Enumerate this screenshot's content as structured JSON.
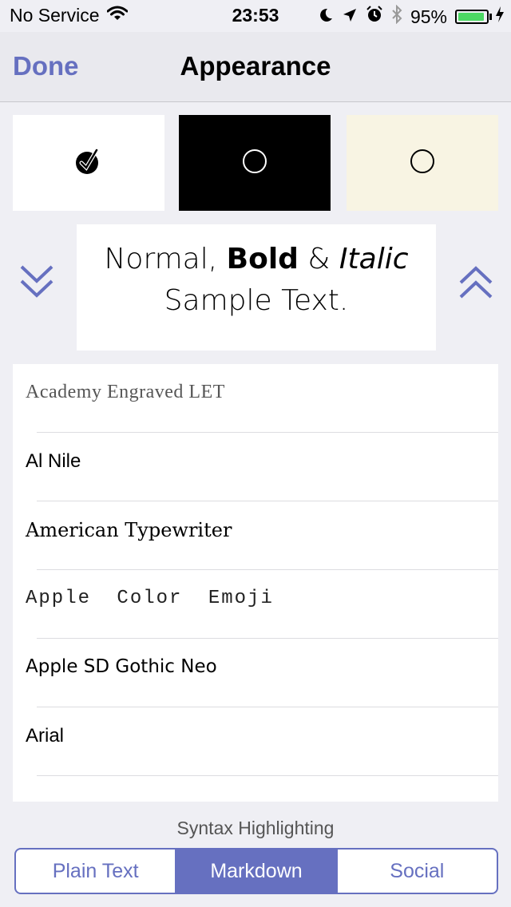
{
  "status_bar": {
    "carrier": "No Service",
    "time": "23:53",
    "battery_percent_label": "95%",
    "battery_level": 0.95,
    "icons": [
      "wifi-icon",
      "moon-icon",
      "location-arrow-icon",
      "alarm-icon",
      "bluetooth-icon",
      "battery-icon",
      "charging-bolt-icon"
    ]
  },
  "nav": {
    "done_label": "Done",
    "title": "Appearance"
  },
  "themes": [
    {
      "name": "white",
      "color": "#ffffff",
      "selected": true
    },
    {
      "name": "black",
      "color": "#000000",
      "selected": false
    },
    {
      "name": "sepia",
      "color": "#f8f4e3",
      "selected": false
    }
  ],
  "sample": {
    "normal": "Normal,",
    "bold": "Bold",
    "amp": "&",
    "italic": "Italic",
    "line2": "Sample Text."
  },
  "fonts": [
    {
      "label": "Academy Engraved LET"
    },
    {
      "label": "Al Nile"
    },
    {
      "label": "American Typewriter"
    },
    {
      "label": "Apple Color Emoji"
    },
    {
      "label": "Apple SD Gothic Neo"
    },
    {
      "label": "Arial"
    }
  ],
  "syntax": {
    "label": "Syntax Highlighting",
    "options": [
      "Plain Text",
      "Markdown",
      "Social"
    ],
    "selected": "Markdown"
  },
  "colors": {
    "accent": "#6670c0",
    "battery_green": "#4cd964"
  }
}
